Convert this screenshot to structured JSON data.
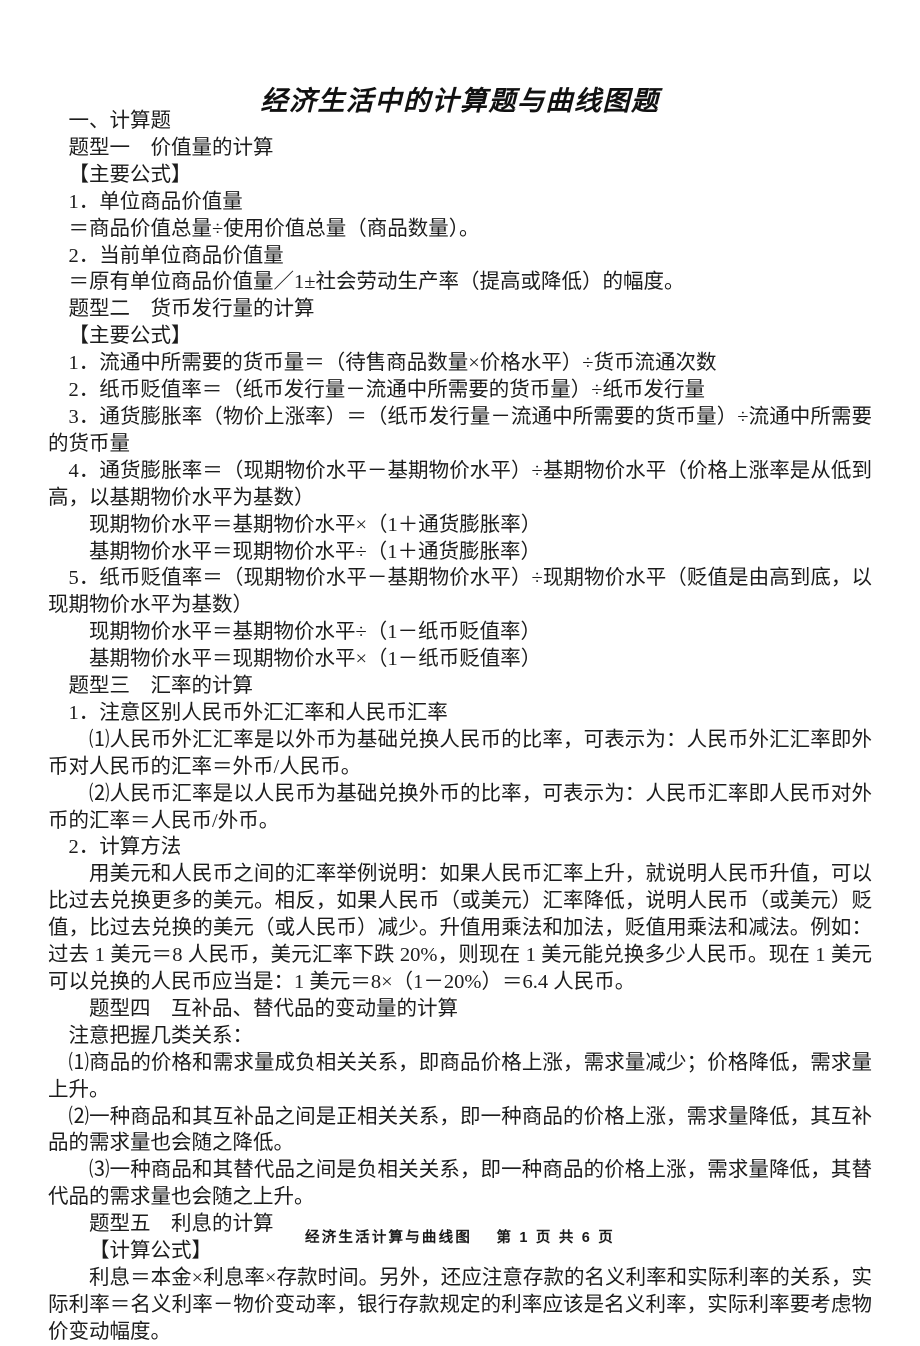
{
  "document": {
    "title": "经济生活中的计算题与曲线图题",
    "footer": {
      "doc_name": "经济生活计算与曲线图",
      "page_label": "第 1 页  共 6 页"
    }
  },
  "content": {
    "lines": [
      {
        "id": "l01",
        "indent": 1,
        "text": "一、计算题"
      },
      {
        "id": "l02",
        "indent": 1,
        "text": "题型一　价值量的计算"
      },
      {
        "id": "l03",
        "indent": 1,
        "text": "【主要公式】"
      },
      {
        "id": "l04",
        "indent": 1,
        "text": "1．单位商品价值量"
      },
      {
        "id": "l05",
        "indent": 1,
        "text": "＝商品价值总量÷使用价值总量（商品数量）。"
      },
      {
        "id": "l06",
        "indent": 1,
        "text": "2．当前单位商品价值量"
      },
      {
        "id": "l07",
        "indent": 1,
        "text": "＝原有单位商品价值量／1±社会劳动生产率（提高或降低）的幅度。"
      },
      {
        "id": "l08",
        "indent": 1,
        "text": "题型二　货币发行量的计算"
      },
      {
        "id": "l09",
        "indent": 1,
        "text": "【主要公式】"
      },
      {
        "id": "l10",
        "indent": 1,
        "text": "1．流通中所需要的货币量＝（待售商品数量×价格水平）÷货币流通次数"
      },
      {
        "id": "l11",
        "indent": 1,
        "text": "2．纸币贬值率＝（纸币发行量－流通中所需要的货币量）÷纸币发行量"
      },
      {
        "id": "l12",
        "indent": 1,
        "text": "3．通货膨胀率（物价上涨率）＝（纸币发行量－流通中所需要的货币量）÷流通中所需要的货币量"
      },
      {
        "id": "l13",
        "indent": 1,
        "text": "4．通货膨胀率＝（现期物价水平－基期物价水平）÷基期物价水平（价格上涨率是从低到高，以基期物价水平为基数）"
      },
      {
        "id": "l14",
        "indent": 2,
        "text": "现期物价水平＝基期物价水平×（1＋通货膨胀率）"
      },
      {
        "id": "l15",
        "indent": 2,
        "text": "基期物价水平＝现期物价水平÷（1＋通货膨胀率）"
      },
      {
        "id": "l16",
        "indent": 1,
        "text": "5．纸币贬值率＝（现期物价水平－基期物价水平）÷现期物价水平（贬值是由高到底，以现期物价水平为基数）"
      },
      {
        "id": "l17",
        "indent": 2,
        "text": "现期物价水平＝基期物价水平÷（1－纸币贬值率）"
      },
      {
        "id": "l18",
        "indent": 2,
        "text": "基期物价水平＝现期物价水平×（1－纸币贬值率）"
      },
      {
        "id": "l19",
        "indent": 1,
        "text": "题型三　汇率的计算"
      },
      {
        "id": "l20",
        "indent": 1,
        "text": "1．注意区别人民币外汇汇率和人民币汇率"
      },
      {
        "id": "l21",
        "indent": 2,
        "text": "⑴人民币外汇汇率是以外币为基础兑换人民币的比率，可表示为：人民币外汇汇率即外币对人民币的汇率＝外币/人民币。"
      },
      {
        "id": "l22",
        "indent": 2,
        "text": "⑵人民币汇率是以人民币为基础兑换外币的比率，可表示为：人民币汇率即人民币对外币的汇率＝人民币/外币。"
      },
      {
        "id": "l23",
        "indent": 1,
        "text": "2．计算方法"
      },
      {
        "id": "l24",
        "indent": 2,
        "text": "用美元和人民币之间的汇率举例说明：如果人民币汇率上升，就说明人民币升值，可以比过去兑换更多的美元。相反，如果人民币（或美元）汇率降低，说明人民币（或美元）贬值，比过去兑换的美元（或人民币）减少。升值用乘法和加法，贬值用乘法和减法。例如：过去 1 美元＝8 人民币，美元汇率下跌 20%，则现在 1 美元能兑换多少人民币。现在 1 美元可以兑换的人民币应当是：1 美元＝8×（1－20%）＝6.4 人民币。"
      },
      {
        "id": "l25",
        "indent": 2,
        "text": "题型四　互补品、替代品的变动量的计算"
      },
      {
        "id": "l26",
        "indent": 1,
        "text": "注意把握几类关系："
      },
      {
        "id": "l27",
        "indent": 1,
        "text": "⑴商品的价格和需求量成负相关关系，即商品价格上涨，需求量减少；价格降低，需求量上升。"
      },
      {
        "id": "l28",
        "indent": 1,
        "text": "⑵一种商品和其互补品之间是正相关关系，即一种商品的价格上涨，需求量降低，其互补品的需求量也会随之降低。"
      },
      {
        "id": "l29",
        "indent": 2,
        "text": "⑶一种商品和其替代品之间是负相关关系，即一种商品的价格上涨，需求量降低，其替代品的需求量也会随之上升。"
      },
      {
        "id": "l30",
        "indent": 2,
        "text": "题型五　利息的计算"
      },
      {
        "id": "l31",
        "indent": 2,
        "text": "【计算公式】"
      },
      {
        "id": "l32",
        "indent": 2,
        "text": "利息＝本金×利息率×存款时间。另外，还应注意存款的名义利率和实际利率的关系，实际利率＝名义利率－物价变动率，银行存款规定的利率应该是名义利率，实际利率要考虑物价变动幅度。"
      }
    ]
  }
}
